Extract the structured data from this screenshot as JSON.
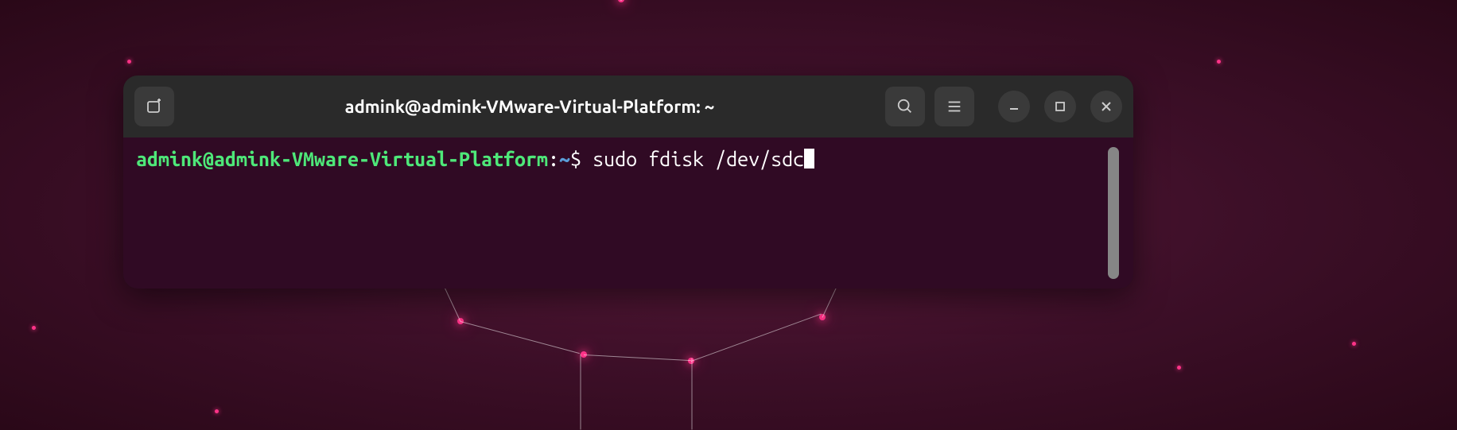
{
  "window": {
    "title": "admink@admink-VMware-Virtual-Platform: ~"
  },
  "prompt": {
    "user_host": "admink@admink-VMware-Virtual-Platform",
    "colon": ":",
    "path": "~",
    "dollar": "$ ",
    "command": "sudo fdisk /dev/sdc"
  }
}
